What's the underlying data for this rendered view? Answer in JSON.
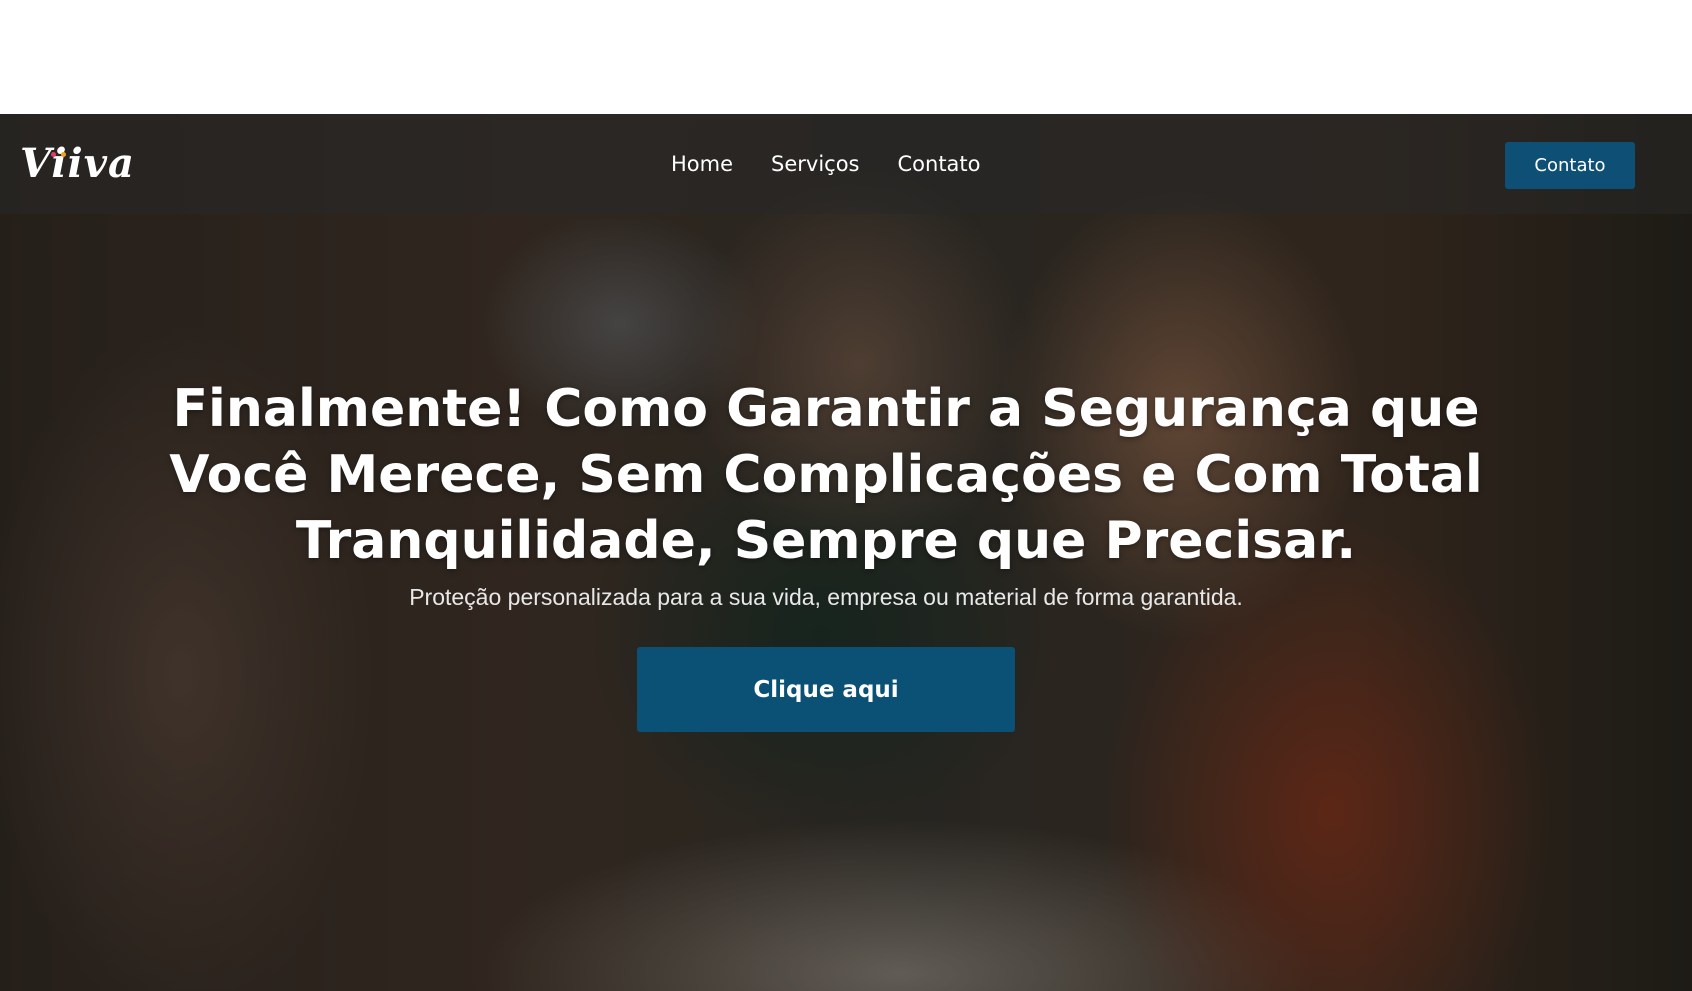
{
  "brand": {
    "logo_text": "Viiva",
    "dot_colors": [
      "#e23b6b",
      "#f2a51f"
    ]
  },
  "nav": {
    "links": [
      "Home",
      "Serviços",
      "Contato"
    ],
    "cta_label": "Contato"
  },
  "hero": {
    "headline": [
      "Finalmente! Como Garantir a Segurança que",
      "Você Merece, Sem Complicações e Com Total",
      "Tranquilidade, Sempre que Precisar."
    ],
    "subtitle": "Proteção personalizada para a sua vida, empresa ou material de forma garantida.",
    "cta_label": "Clique aqui"
  },
  "colors": {
    "button": "#0b5176",
    "navbar_overlay": "rgba(40,40,40,0.55)"
  }
}
